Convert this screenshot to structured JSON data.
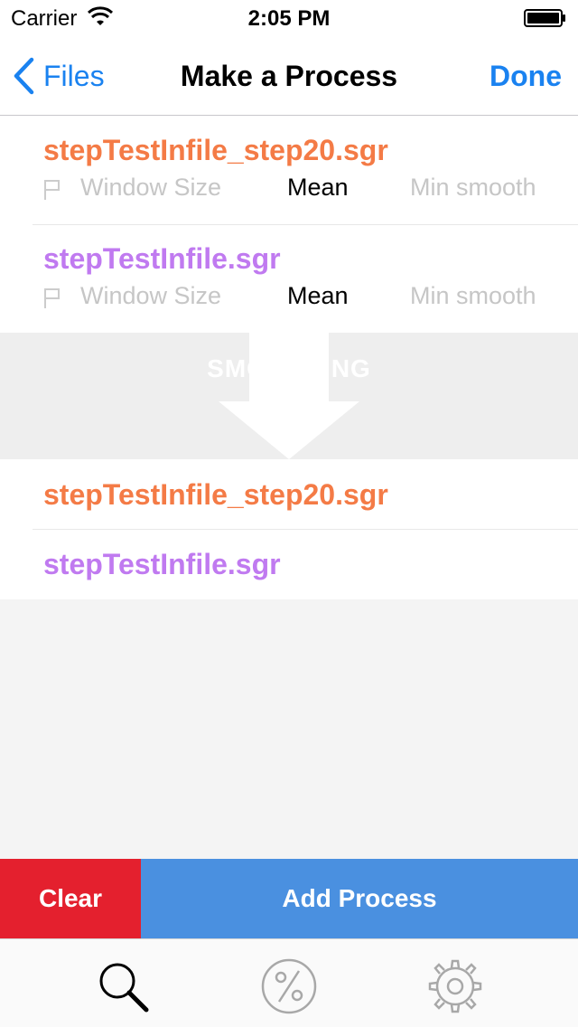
{
  "status_bar": {
    "carrier": "Carrier",
    "time": "2:05 PM"
  },
  "nav": {
    "back_label": "Files",
    "title": "Make a Process",
    "done_label": "Done"
  },
  "colors": {
    "accent": "#1a82f0",
    "file_orange": "#f47b46",
    "file_purple": "#c07af0",
    "clear_red": "#e4202e",
    "add_blue": "#4a90e0"
  },
  "inputs": [
    {
      "file": "stepTestInfile_step20.sgr",
      "color": "#f47b46",
      "window_size": "Window Size",
      "method": "Mean",
      "min_smooth": "Min smooth"
    },
    {
      "file": "stepTestInfile.sgr",
      "color": "#c07af0",
      "window_size": "Window Size",
      "method": "Mean",
      "min_smooth": "Min smooth"
    }
  ],
  "process": {
    "label": "SMOOTHING"
  },
  "outputs": [
    {
      "file": "stepTestInfile_step20.sgr",
      "color": "#f47b46"
    },
    {
      "file": "stepTestInfile.sgr",
      "color": "#c07af0"
    }
  ],
  "actions": {
    "clear_label": "Clear",
    "add_label": "Add Process"
  },
  "tabs": [
    {
      "icon": "search-icon",
      "selected": true
    },
    {
      "icon": "percent-icon",
      "selected": false
    },
    {
      "icon": "gear-icon",
      "selected": false
    }
  ]
}
